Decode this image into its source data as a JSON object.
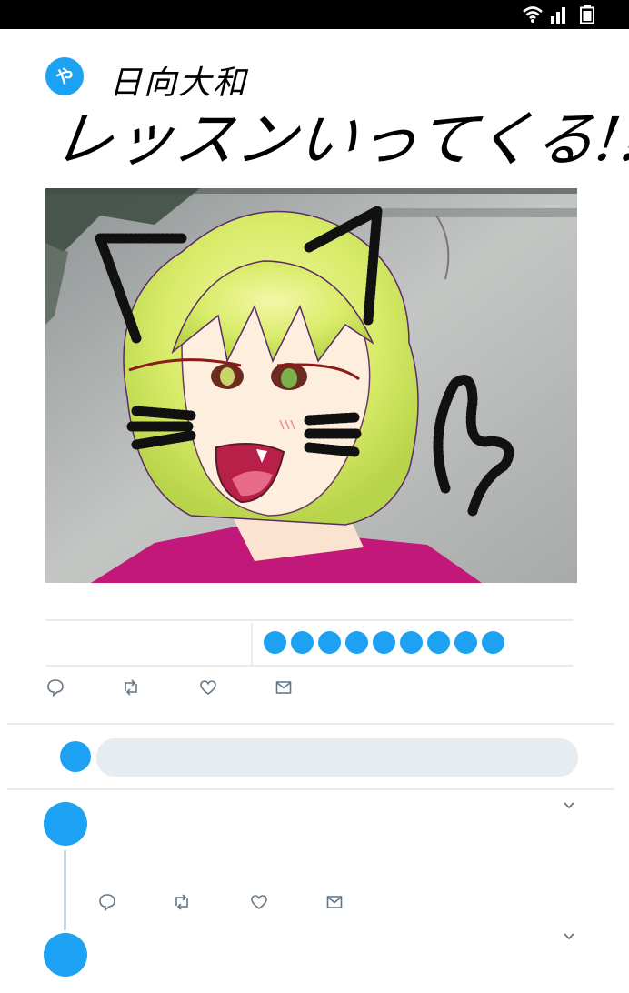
{
  "tweet": {
    "avatar_glyph": "や",
    "author_name": "日向大和",
    "headline": "レッスンいってくる!!!",
    "image_alt": "Illustration of a yellow-haired character with drawn-on cat ears, whiskers and tail"
  },
  "stats": {
    "dot_count": 9
  },
  "actions": [
    "reply-icon",
    "retweet-icon",
    "like-icon",
    "dm-icon"
  ],
  "reply_box": {
    "placeholder": ""
  },
  "colors": {
    "accent": "#1da1f2",
    "divider": "#e6ecf0",
    "status_bar": "#000000"
  }
}
